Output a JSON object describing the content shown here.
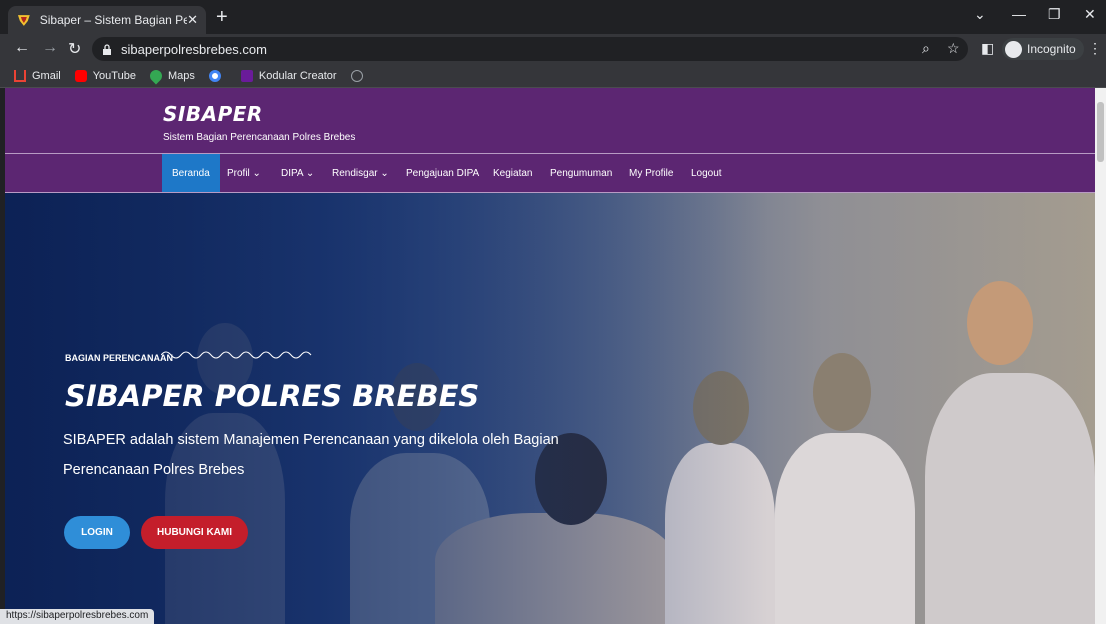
{
  "tab": {
    "title": "Sibaper – Sistem Bagian Perencan",
    "close": "✕",
    "new_tab": "+"
  },
  "window": {
    "minimize": "—",
    "restore": "❐",
    "close": "✕",
    "dropdown": "⌄"
  },
  "omnibox": {
    "url": "sibaperpolresbrebes.com",
    "incognito_label": "Incognito"
  },
  "bookmarks": [
    {
      "label": "Gmail",
      "icon": "gmail-icon",
      "color": "#ea4335"
    },
    {
      "label": "YouTube",
      "icon": "youtube-icon",
      "color": "#ff0000"
    },
    {
      "label": "Maps",
      "icon": "maps-icon",
      "color": "#34a853"
    },
    {
      "label": "",
      "icon": "google-icon",
      "color": "#4285f4"
    },
    {
      "label": "Kodular Creator",
      "icon": "kodular-icon",
      "color": "#6a1b9a"
    }
  ],
  "site": {
    "brand": "SIBAPER",
    "tagline": "Sistem Bagian Perencanaan Polres Brebes",
    "nav": [
      {
        "label": "Beranda"
      },
      {
        "label": "Profil ⌄"
      },
      {
        "label": "DIPA ⌄"
      },
      {
        "label": "Rendisgar ⌄"
      },
      {
        "label": "Pengajuan DIPA"
      },
      {
        "label": "Kegiatan"
      },
      {
        "label": "Pengumuman"
      },
      {
        "label": "My Profile"
      },
      {
        "label": "Logout"
      }
    ]
  },
  "hero": {
    "kicker": "BAGIAN PERENCANAAN",
    "title": "SIBAPER POLRES BREBES",
    "description": "SIBAPER adalah sistem Manajemen Perencanaan yang dikelola oleh Bagian Perencanaan Polres Brebes",
    "login_label": "LOGIN",
    "contact_label": "HUBUNGI KAMI"
  },
  "status_bar": {
    "url": "https://sibaperpolresbrebes.com"
  },
  "colors": {
    "header_purple": "#5c2672",
    "nav_active": "#1e78c8",
    "login_blue": "#2f8ed8",
    "contact_red": "#c41e2b"
  }
}
